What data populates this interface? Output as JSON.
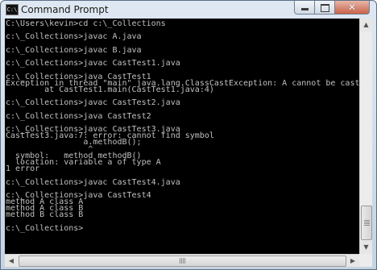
{
  "window": {
    "title": "Command Prompt",
    "icon_label": "C:\\",
    "buttons": {
      "minimize_icon": "minimize-icon",
      "maximize_icon": "maximize-icon",
      "close_icon": "close-icon",
      "close_glyph": "✕"
    }
  },
  "console": {
    "background": "#000000",
    "foreground": "#c0c0c0",
    "lines": [
      "C:\\Users\\kevin>cd c:\\_Collections",
      "",
      "c:\\_Collections>javac A.java",
      "",
      "c:\\_Collections>javac B.java",
      "",
      "c:\\_Collections>javac CastTest1.java",
      "",
      "c:\\_Collections>java CastTest1",
      "Exception in thread \"main\" java.lang.ClassCastException: A cannot be cast to B",
      "        at CastTest1.main(CastTest1.java:4)",
      "",
      "c:\\_Collections>javac CastTest2.java",
      "",
      "c:\\_Collections>java CastTest2",
      "",
      "c:\\_Collections>javac CastTest3.java",
      "CastTest3.java:7: error: cannot find symbol",
      "                a.methodB();",
      "                 ^",
      "  symbol:   method methodB()",
      "  location: variable a of type A",
      "1 error",
      "",
      "c:\\_Collections>javac CastTest4.java",
      "",
      "c:\\_Collections>java CastTest4",
      "method A class A",
      "method A class B",
      "method B class B",
      "",
      "c:\\_Collections>",
      ""
    ]
  },
  "scrollbars": {
    "up_icon": "scroll-up-arrow-icon",
    "down_icon": "scroll-down-arrow-icon",
    "left_icon": "scroll-left-arrow-icon",
    "right_icon": "scroll-right-arrow-icon",
    "up_glyph": "▲",
    "down_glyph": "▼",
    "left_glyph": "◀",
    "right_glyph": "▶"
  }
}
